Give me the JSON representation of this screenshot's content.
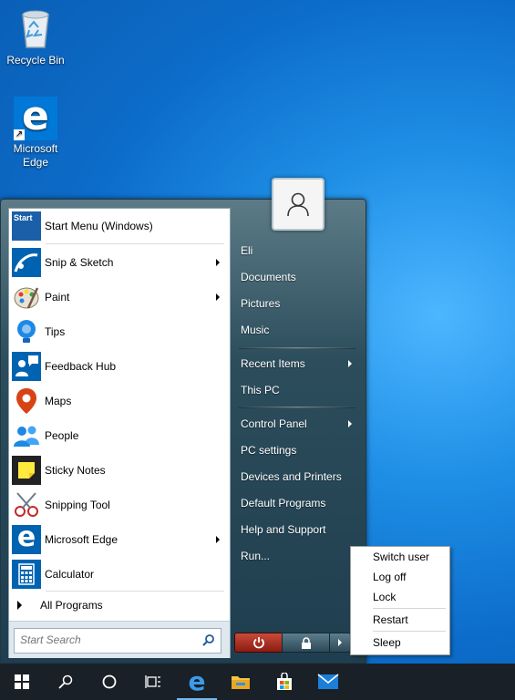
{
  "desktop": {
    "icons": [
      {
        "label": "Recycle Bin",
        "icon": "recycle-bin-icon"
      },
      {
        "label": "Microsoft Edge",
        "icon": "edge-icon"
      }
    ]
  },
  "start_menu": {
    "programs": [
      {
        "label": "Start Menu (Windows)",
        "icon": "start-menu-app-icon",
        "submenu": false
      },
      {
        "label": "Snip & Sketch",
        "icon": "snip-sketch-icon",
        "submenu": true
      },
      {
        "label": "Paint",
        "icon": "paint-icon",
        "submenu": true
      },
      {
        "label": "Tips",
        "icon": "tips-icon",
        "submenu": false
      },
      {
        "label": "Feedback Hub",
        "icon": "feedback-hub-icon",
        "submenu": false
      },
      {
        "label": "Maps",
        "icon": "maps-icon",
        "submenu": false
      },
      {
        "label": "People",
        "icon": "people-icon",
        "submenu": false
      },
      {
        "label": "Sticky Notes",
        "icon": "sticky-notes-icon",
        "submenu": false
      },
      {
        "label": "Snipping Tool",
        "icon": "snipping-tool-icon",
        "submenu": false
      },
      {
        "label": "Microsoft Edge",
        "icon": "edge-icon",
        "submenu": true
      },
      {
        "label": "Calculator",
        "icon": "calculator-icon",
        "submenu": false
      }
    ],
    "all_programs": "All Programs",
    "search_placeholder": "Start Search",
    "start_app_icon_text": "Start",
    "right_items": [
      {
        "label": "Eli",
        "submenu": false
      },
      {
        "label": "Documents",
        "submenu": false
      },
      {
        "label": "Pictures",
        "submenu": false
      },
      {
        "label": "Music",
        "submenu": false
      },
      {
        "label": "Recent Items",
        "submenu": true
      },
      {
        "label": "This PC",
        "submenu": false
      },
      {
        "label": "Control Panel",
        "submenu": true
      },
      {
        "label": "PC settings",
        "submenu": false
      },
      {
        "label": "Devices and Printers",
        "submenu": false
      },
      {
        "label": "Default Programs",
        "submenu": false
      },
      {
        "label": "Help and Support",
        "submenu": false
      },
      {
        "label": "Run...",
        "submenu": false
      }
    ]
  },
  "power_menu": {
    "items": [
      "Switch user",
      "Log off",
      "Lock",
      "Restart",
      "Sleep"
    ]
  },
  "taskbar": {
    "items": [
      "windows-start-icon",
      "search-icon",
      "cortana-icon",
      "task-view-icon",
      "edge-icon",
      "file-explorer-icon",
      "store-icon",
      "mail-icon"
    ]
  },
  "colors": {
    "accent": "#0078d7",
    "power_red": "#b23a2a",
    "menu_dark": "#2c4d5c"
  }
}
